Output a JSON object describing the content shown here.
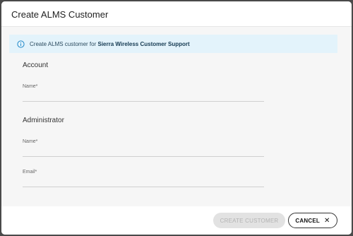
{
  "dialog": {
    "title": "Create ALMS Customer"
  },
  "banner": {
    "prefix": "Create ALMS customer for ",
    "org": "Sierra Wireless Customer Support",
    "icon": "info-circle-icon",
    "accent": "#1e88c9"
  },
  "account": {
    "title": "Account",
    "name_label": "Name*",
    "name_value": ""
  },
  "administrator": {
    "title": "Administrator",
    "name_label": "Name*",
    "name_value": "",
    "email_label": "Email*",
    "email_value": ""
  },
  "footer": {
    "create_label": "CREATE CUSTOMER",
    "cancel_label": "CANCEL",
    "cancel_icon": "close-icon"
  }
}
